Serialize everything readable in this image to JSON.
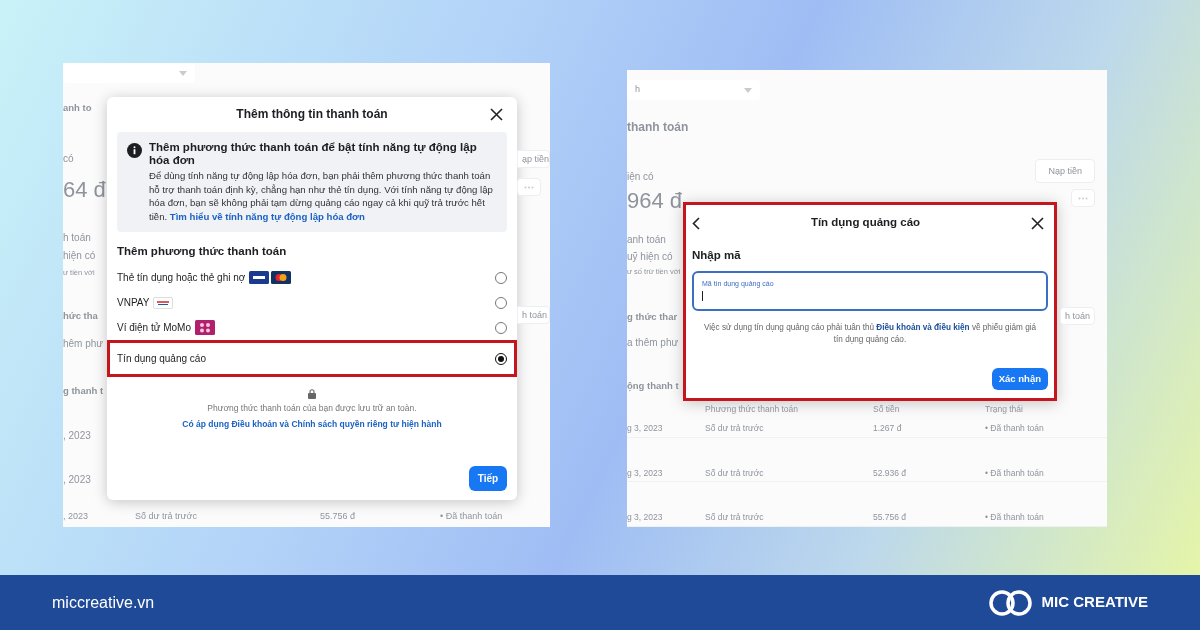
{
  "left_screen": {
    "strip_left": [
      {
        "kind": "heading",
        "text": "anh to"
      },
      {
        "kind": "label",
        "text": "có"
      },
      {
        "kind": "amount",
        "text": "64 đ"
      },
      {
        "kind": "label",
        "text": "h toán"
      },
      {
        "kind": "label",
        "text": "hiện có"
      },
      {
        "kind": "caption",
        "text": "ư tiền với"
      },
      {
        "kind": "heading",
        "text": "hức tha"
      },
      {
        "kind": "label",
        "text": "hêm phư"
      },
      {
        "kind": "heading",
        "text": "g thanh t"
      },
      {
        "kind": "label",
        "text": ", 2023"
      },
      {
        "kind": "label",
        "text": ", 2023"
      }
    ],
    "strip_right": [
      {
        "kind": "button",
        "text": "ạp tiền"
      },
      {
        "kind": "more"
      },
      {
        "kind": "button",
        "text": "h toán"
      }
    ],
    "bottom_row": [
      ", 2023",
      "Số dư trả trước",
      "55.756 đ",
      "• Đã thanh toán"
    ],
    "modal": {
      "title": "Thêm thông tin thanh toán",
      "notice": {
        "title": "Thêm phương thức thanh toán để bật tính năng tự động lập hóa đơn",
        "body": "Để dùng tính năng tự động lập hóa đơn, bạn phải thêm phương thức thanh toán hỗ trợ thanh toán định kỳ, chẳng hạn như thẻ tín dụng. Với tính năng tự động lập hóa đơn, bạn sẽ không phải tạm dừng quảng cáo ngay cả khi quỹ trả trước hết tiền.",
        "link": "Tìm hiểu về tính năng tự động lập hóa đơn"
      },
      "section_title": "Thêm phương thức thanh toán",
      "options": [
        {
          "label": "Thẻ tín dụng hoặc thẻ ghi nợ",
          "kind": "card",
          "selected": false,
          "highlighted": false
        },
        {
          "label": "VNPAY",
          "kind": "vnpay",
          "selected": false,
          "highlighted": false
        },
        {
          "label": "Ví điện tử MoMo",
          "kind": "momo",
          "selected": false,
          "highlighted": false
        },
        {
          "label": "Tín dụng quảng cáo",
          "kind": "plain",
          "selected": true,
          "highlighted": true
        }
      ],
      "secure_note": "Phương thức thanh toán của bạn được lưu trữ an toàn.",
      "terms_link": "Có áp dụng Điều khoản và Chính sách quyền riêng tư hiện hành",
      "button": "Tiếp"
    }
  },
  "right_screen": {
    "dropdown": {
      "text": "h"
    },
    "heading": "thanh toán",
    "balance_label": "iện có",
    "top_button": "Nạp tiền",
    "strip_left": [
      {
        "kind": "amount",
        "text": "964 đ"
      },
      {
        "kind": "label",
        "text": "anh toán"
      },
      {
        "kind": "label",
        "text": "uỹ hiện có"
      },
      {
        "kind": "caption",
        "text": "ư số trừ tiền với"
      },
      {
        "kind": "heading",
        "text": "g thức thar"
      },
      {
        "kind": "label",
        "text": "a thêm phư"
      },
      {
        "kind": "heading",
        "text": "ộng thanh t"
      }
    ],
    "strip_right": [
      {
        "kind": "more"
      },
      {
        "kind": "button",
        "text": "h toán"
      }
    ],
    "table": {
      "columns": [
        "",
        "Phương thức thanh toán",
        "Số tiền",
        "Trạng thái"
      ],
      "rows": [
        [
          "g 3, 2023",
          "Số dư trả trước",
          "1.267 đ",
          "• Đã thanh toán"
        ],
        [
          "g 3, 2023",
          "Số dư trả trước",
          "52.936 đ",
          "• Đã thanh toán"
        ],
        [
          "g 3, 2023",
          "Số dư trả trước",
          "55.756 đ",
          "• Đã thanh toán"
        ]
      ]
    },
    "modal": {
      "title": "Tín dụng quảng cáo",
      "highlighted": true,
      "section_title": "Nhập mã",
      "field": {
        "label": "Mã tín dụng quảng cáo",
        "focused": true
      },
      "note_before": "Việc sử dụng tín dụng quảng cáo phải tuân thủ",
      "note_link": "Điều khoản và điều kiện",
      "note_after": "về phiếu giảm giá tín dụng quảng cáo.",
      "button": "Xác nhận"
    }
  },
  "footer": {
    "site": "miccreative.vn",
    "brand": "MIC CREATIVE"
  }
}
